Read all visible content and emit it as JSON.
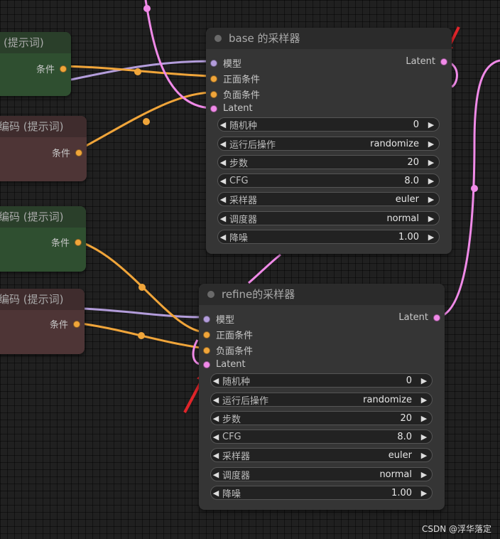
{
  "colors": {
    "model_wire": "#b39ddb",
    "cond_wire": "#f0a53a",
    "latent_wire": "#f08ae8",
    "red_arrow": "#e0252a"
  },
  "nodes": {
    "encode_top_green": {
      "title": "(提示词)",
      "output": "条件"
    },
    "encode_top_red": {
      "title": "编码 (提示词)",
      "output": "条件"
    },
    "encode_bottom_green": {
      "title": "编码 (提示词)",
      "output": "条件"
    },
    "encode_bottom_red": {
      "title": "编码 (提示词)",
      "output": "条件"
    }
  },
  "base_sampler": {
    "title": "base 的采样器",
    "inputs": [
      "模型",
      "正面条件",
      "负面条件",
      "Latent"
    ],
    "output": "Latent",
    "widgets": [
      {
        "label": "随机种",
        "value": "0"
      },
      {
        "label": "运行后操作",
        "value": "randomize"
      },
      {
        "label": "步数",
        "value": "20"
      },
      {
        "label": "CFG",
        "value": "8.0"
      },
      {
        "label": "采样器",
        "value": "euler"
      },
      {
        "label": "调度器",
        "value": "normal"
      },
      {
        "label": "降噪",
        "value": "1.00"
      }
    ]
  },
  "refine_sampler": {
    "title": "refine的采样器",
    "inputs": [
      "模型",
      "正面条件",
      "负面条件",
      "Latent"
    ],
    "output": "Latent",
    "widgets": [
      {
        "label": "随机种",
        "value": "0"
      },
      {
        "label": "运行后操作",
        "value": "randomize"
      },
      {
        "label": "步数",
        "value": "20"
      },
      {
        "label": "CFG",
        "value": "8.0"
      },
      {
        "label": "采样器",
        "value": "euler"
      },
      {
        "label": "调度器",
        "value": "normal"
      },
      {
        "label": "降噪",
        "value": "1.00"
      }
    ]
  },
  "watermark": "CSDN @浮华落定"
}
